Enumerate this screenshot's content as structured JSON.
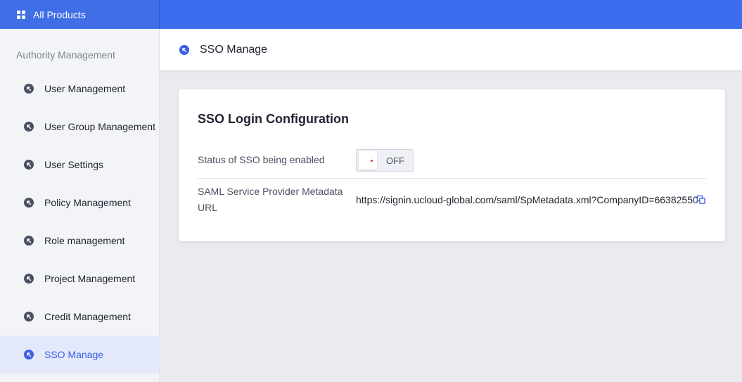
{
  "topbar": {
    "products_label": "All Products",
    "icon": "grid-icon"
  },
  "sidebar": {
    "section_title": "Authority Management",
    "items": [
      {
        "label": "User Management",
        "icon": "arrow-circle-icon",
        "active": false
      },
      {
        "label": "User Group Management",
        "icon": "arrow-circle-icon",
        "active": false
      },
      {
        "label": "User Settings",
        "icon": "arrow-circle-icon",
        "active": false
      },
      {
        "label": "Policy Management",
        "icon": "arrow-circle-icon",
        "active": false
      },
      {
        "label": "Role management",
        "icon": "arrow-circle-icon",
        "active": false
      },
      {
        "label": "Project Management",
        "icon": "arrow-circle-icon",
        "active": false
      },
      {
        "label": "Credit Management",
        "icon": "arrow-circle-icon",
        "active": false
      },
      {
        "label": "SSO Manage",
        "icon": "arrow-circle-icon",
        "active": true
      }
    ]
  },
  "header": {
    "title": "SSO Manage",
    "icon": "arrow-circle-icon"
  },
  "card": {
    "title": "SSO Login Configuration",
    "status_label": "Status of SSO being enabled",
    "toggle_state": "OFF",
    "metadata_label": "SAML Service Provider Metadata URL",
    "metadata_url": "https://signin.ucloud-global.com/saml/SpMetadata.xml?CompanyID=66382550",
    "copy_icon": "copy-icon"
  },
  "colors": {
    "brand_blue": "#3b6cf0",
    "active_accent": "#3b5ee6",
    "toggle_off_dot": "#e0312e"
  }
}
